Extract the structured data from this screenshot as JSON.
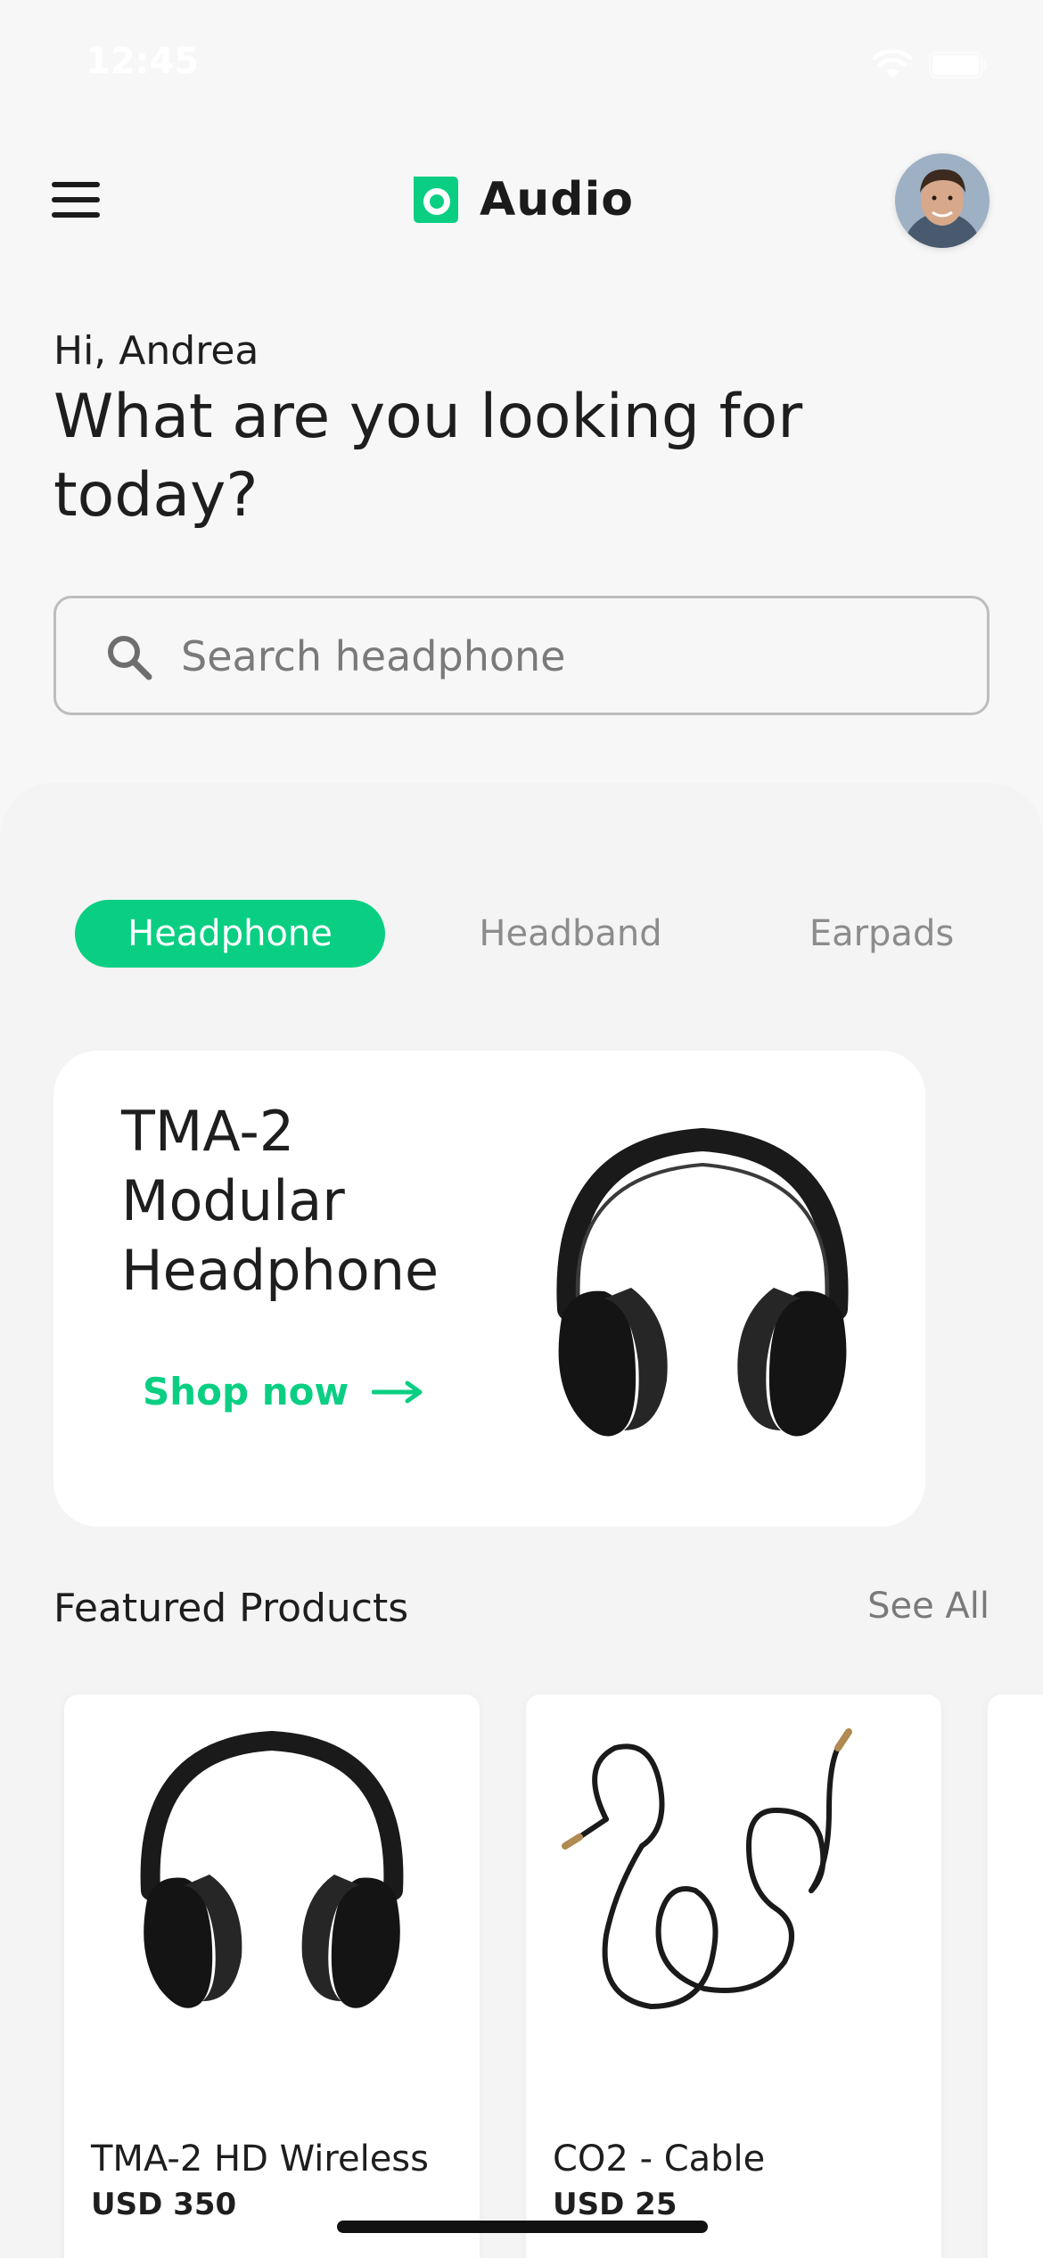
{
  "status_bar": {
    "time": "12:45"
  },
  "header": {
    "logo_text": "Audio",
    "avatar_alt": "User avatar"
  },
  "greeting": {
    "hello": "Hi, Andrea",
    "headline": "What are you looking for today?"
  },
  "search": {
    "placeholder": "Search headphone",
    "value": ""
  },
  "tabs": [
    {
      "label": "Headphone",
      "active": true
    },
    {
      "label": "Headband",
      "active": false
    },
    {
      "label": "Earpads",
      "active": false
    }
  ],
  "promo": {
    "title": "TMA-2 Modular Headphone",
    "cta": "Shop now"
  },
  "featured": {
    "title": "Featured Products",
    "see_all": "See All",
    "products": [
      {
        "name": "TMA-2 HD Wireless",
        "price": "USD 350"
      },
      {
        "name": "CO2 - Cable",
        "price": "USD 25"
      }
    ]
  },
  "colors": {
    "accent": "#0acf83",
    "background": "#f7f7f7",
    "text": "#1e1e1e",
    "muted": "#8c8c8c"
  },
  "icons": {
    "menu": "hamburger-menu-icon",
    "search": "search-icon",
    "arrow": "arrow-right-icon",
    "logo": "audio-logo-icon"
  }
}
